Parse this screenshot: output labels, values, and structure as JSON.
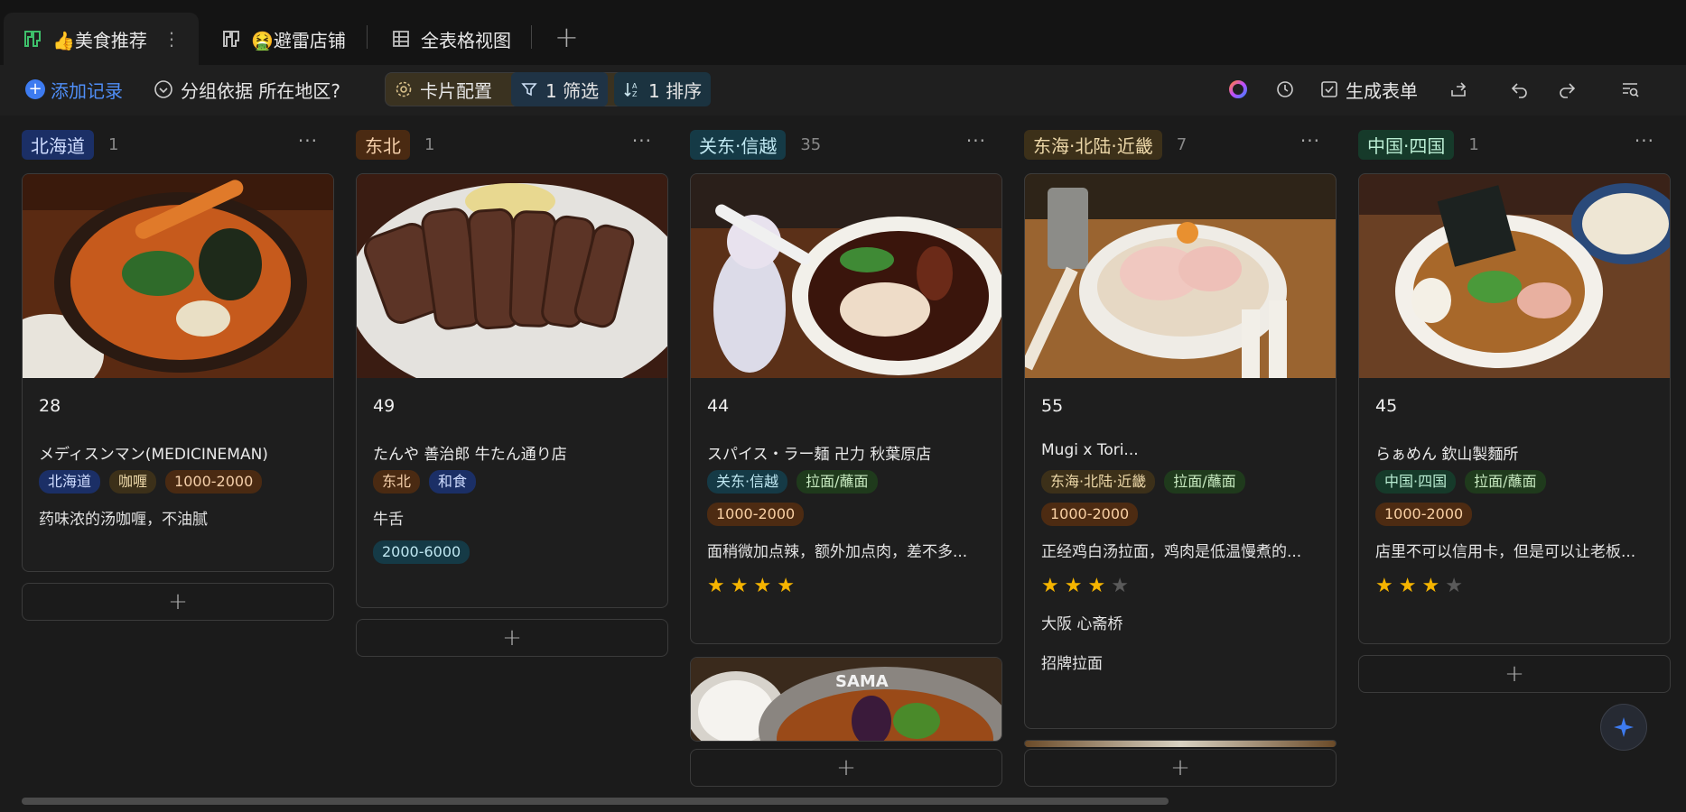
{
  "tabs": [
    {
      "label": "👍美食推荐",
      "active": true
    },
    {
      "label": "🤮避雷店铺",
      "active": false
    },
    {
      "label": "全表格视图",
      "active": false
    }
  ],
  "toolbar": {
    "add_record": "添加记录",
    "group_by": "分组依据 所在地区?",
    "card_config": "卡片配置",
    "filter": "1 筛选",
    "sort": "1 排序",
    "generate_form": "生成表单"
  },
  "colors": {
    "accent": "#3d7bf0",
    "star": "#f5b400"
  },
  "columns": [
    {
      "name": "北海道",
      "count": "1",
      "cards": [
        {
          "num": "28",
          "title": "メディスンマン(MEDICINEMAN)",
          "tags": [
            "北海道",
            "咖喱",
            "1000-2000"
          ],
          "desc": "药味浓的汤咖喱，不油腻"
        }
      ]
    },
    {
      "name": "东北",
      "count": "1",
      "cards": [
        {
          "num": "49",
          "title": "たんや 善治郎 牛たん通り店",
          "tags": [
            "东北",
            "和食"
          ],
          "desc": "牛舌",
          "price": "2000-6000"
        }
      ]
    },
    {
      "name": "关东·信越",
      "count": "35",
      "cards": [
        {
          "num": "44",
          "title": "スパイス・ラー麺 卍力 秋葉原店",
          "tags": [
            "关东·信越",
            "拉面/蘸面"
          ],
          "price": "1000-2000",
          "desc": "面稍微加点辣，额外加点肉，差不多...",
          "stars": 4
        }
      ]
    },
    {
      "name": "东海·北陆·近畿",
      "count": "7",
      "cards": [
        {
          "num": "55",
          "title": "Mugi x Tori...",
          "tags": [
            "东海·北陆·近畿",
            "拉面/蘸面"
          ],
          "price": "1000-2000",
          "desc": "正经鸡白汤拉面，鸡肉是低温慢煮的...",
          "stars": 3,
          "area": "大阪 心斋桥",
          "dish": "招牌拉面"
        }
      ]
    },
    {
      "name": "中国·四国",
      "count": "1",
      "cards": [
        {
          "num": "45",
          "title": "らぁめん 欽山製麵所",
          "tags": [
            "中国·四国",
            "拉面/蘸面"
          ],
          "price": "1000-2000",
          "desc": "店里不可以信用卡，但是可以让老板...",
          "stars": 3
        }
      ]
    }
  ]
}
